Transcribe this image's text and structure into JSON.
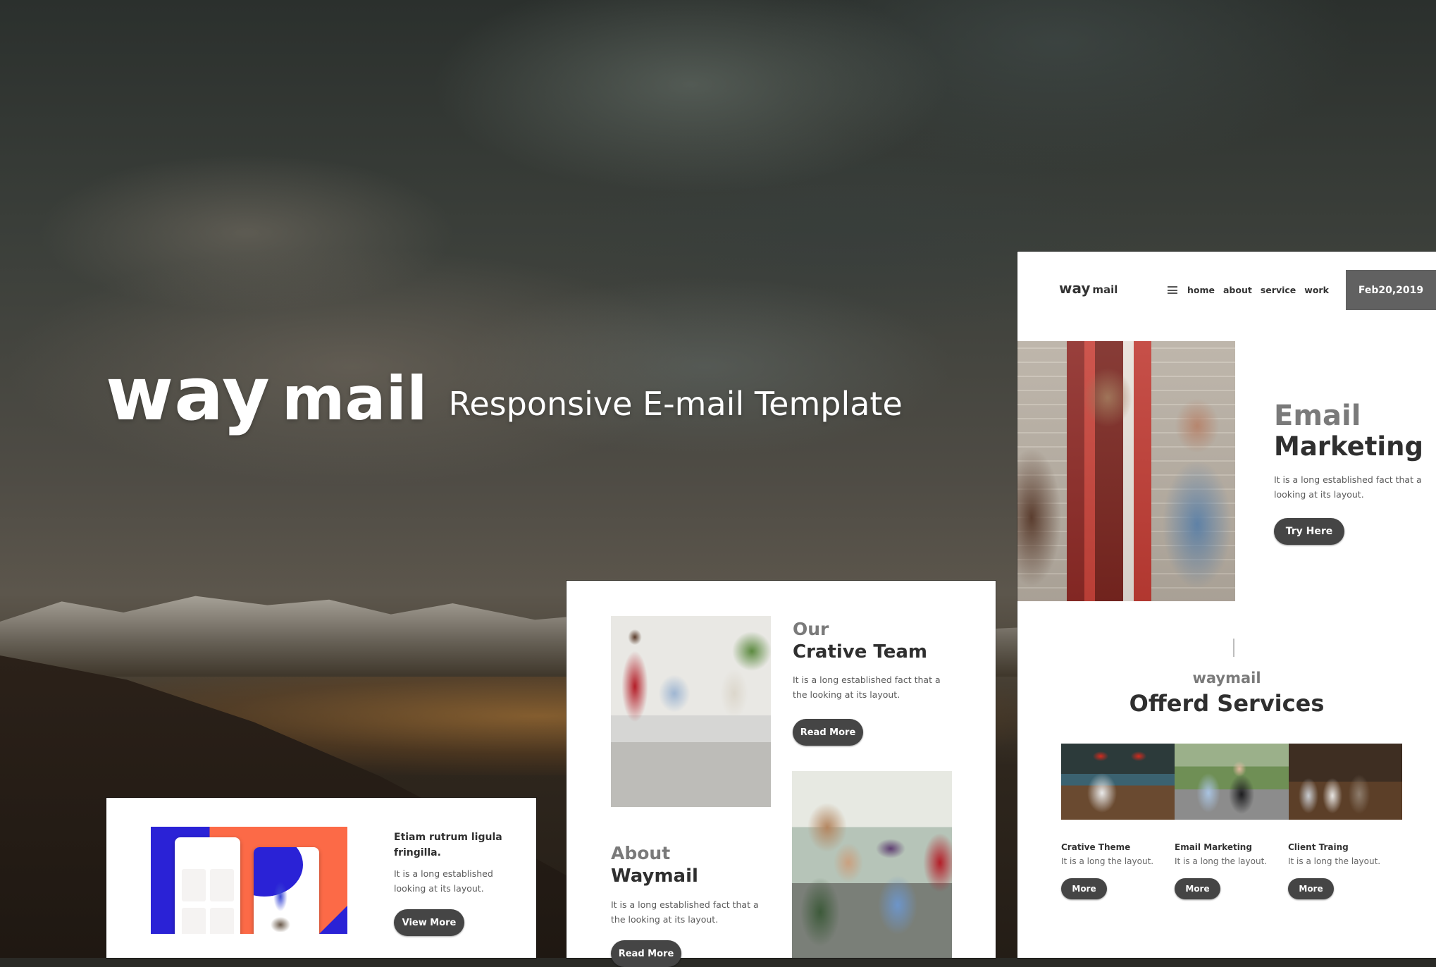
{
  "hero": {
    "brand_way": "way",
    "brand_mail": "mail",
    "tagline": "Responsive E-mail Template"
  },
  "newsletter": {
    "logo_way": "way",
    "logo_mail": "mail",
    "menu_icon": "hamburger-icon",
    "nav": [
      {
        "label": "home"
      },
      {
        "label": "about"
      },
      {
        "label": "service"
      },
      {
        "label": "work"
      }
    ],
    "date": "Feb20,2019",
    "feature": {
      "title_line1": "Email",
      "title_line2": "Marketing",
      "body": "It is a long established fact that a looking at its layout.",
      "button": "Try Here"
    },
    "services": {
      "kicker": "waymail",
      "title": "Offerd Services",
      "items": [
        {
          "name": "Crative Theme",
          "desc": "It is a long the layout.",
          "button": "More"
        },
        {
          "name": "Email Marketing",
          "desc": "It is a long the layout.",
          "button": "More"
        },
        {
          "name": "Client Traing",
          "desc": "It is a long the layout.",
          "button": "More"
        }
      ]
    }
  },
  "team_card": {
    "team": {
      "title_line1": "Our",
      "title_line2": "Crative Team",
      "body": "It is a long established fact that a the looking at its layout.",
      "button": "Read More"
    },
    "about": {
      "title_line1": "About",
      "title_line2": "Waymail",
      "body": "It is a long established fact that a the looking at its layout.",
      "button": "Read More"
    }
  },
  "app_card": {
    "title": "Etiam rutrum ligula fringilla.",
    "body": "It is a long established looking at its layout.",
    "button": "View More"
  },
  "colors": {
    "button_bg": "#454545",
    "date_bg": "#616161",
    "heading_grey": "#7a7a7a",
    "heading_dark": "#2f2f2f",
    "app_blue": "#2a22d6",
    "app_orange": "#fc6a47"
  }
}
